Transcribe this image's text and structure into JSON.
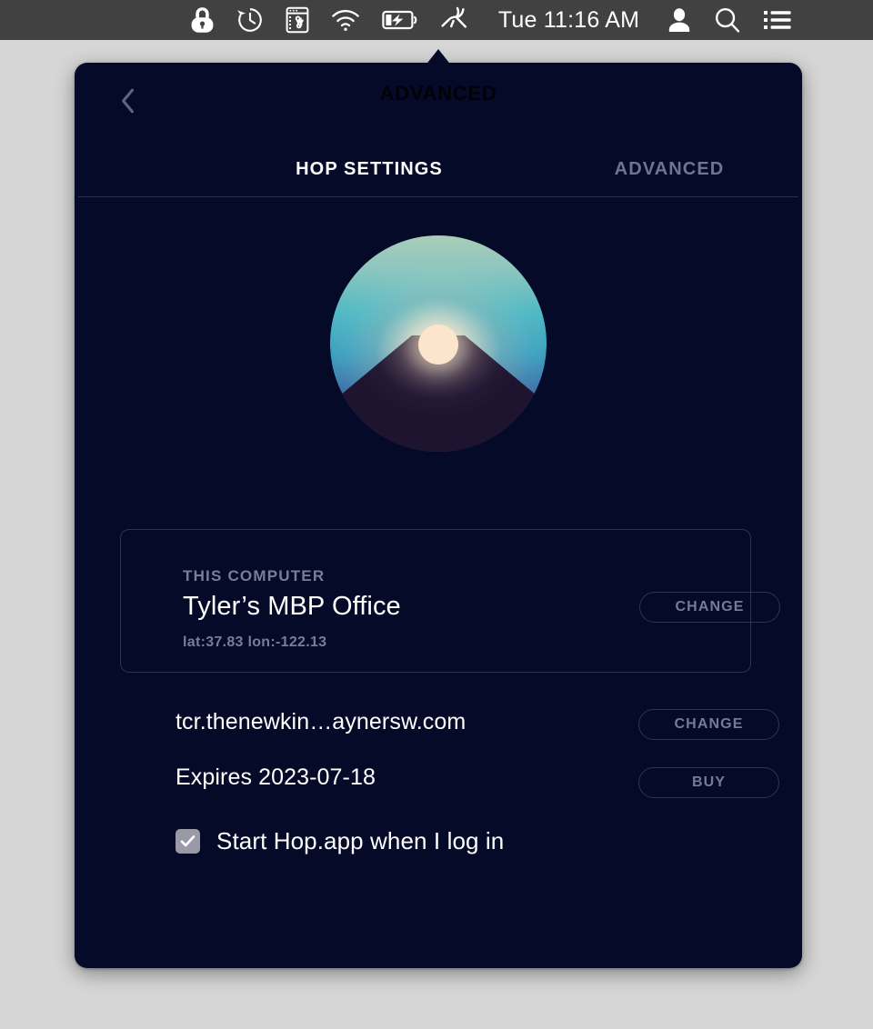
{
  "menubar": {
    "icons": [
      {
        "name": "lock-icon",
        "label": "Lock"
      },
      {
        "name": "time-machine-icon",
        "label": "Time Machine"
      },
      {
        "name": "keyboard-shortcut-icon",
        "label": "Keyboard Shortcuts"
      },
      {
        "name": "wifi-icon",
        "label": "Wi-Fi"
      },
      {
        "name": "battery-charging-icon",
        "label": "Battery Charging"
      },
      {
        "name": "hop-rabbit-icon",
        "label": "Hop"
      }
    ],
    "clock": "Tue 11:16 AM",
    "right_icons": [
      {
        "name": "user-account-icon",
        "label": "User"
      },
      {
        "name": "spotlight-search-icon",
        "label": "Spotlight Search"
      },
      {
        "name": "notification-center-icon",
        "label": "Notification Center"
      }
    ]
  },
  "popover": {
    "title": "ADVANCED",
    "back_label": "Back",
    "tabs": [
      {
        "id": "hop-settings",
        "label": "HOP SETTINGS",
        "active": true
      },
      {
        "id": "advanced",
        "label": "ADVANCED",
        "active": false
      }
    ],
    "logo": {
      "name": "hop-sunrise-logo",
      "sky_top_color": "#a9cdb7",
      "sky_bottom_color": "#2f3b72",
      "sun_color": "#fbe6cd",
      "land_color": "#1e1430"
    },
    "computer_card": {
      "label": "THIS COMPUTER",
      "name": "Tyler’s MBP Office",
      "coordinates": "lat:37.83 lon:-122.13",
      "change_button": "CHANGE"
    },
    "domain_row": {
      "value": "tcr.thenewkin…aynersw.com",
      "change_button": "CHANGE"
    },
    "expires_row": {
      "value": "Expires 2023-07-18",
      "buy_button": "BUY"
    },
    "startup": {
      "label": "Start Hop.app when I log in",
      "checked": true
    }
  },
  "colors": {
    "menubar_bg": "#414141",
    "desktop_bg": "#d6d6d6",
    "popover_bg": "#050a28",
    "muted_text": "#757a95",
    "border": "#2f3452"
  }
}
